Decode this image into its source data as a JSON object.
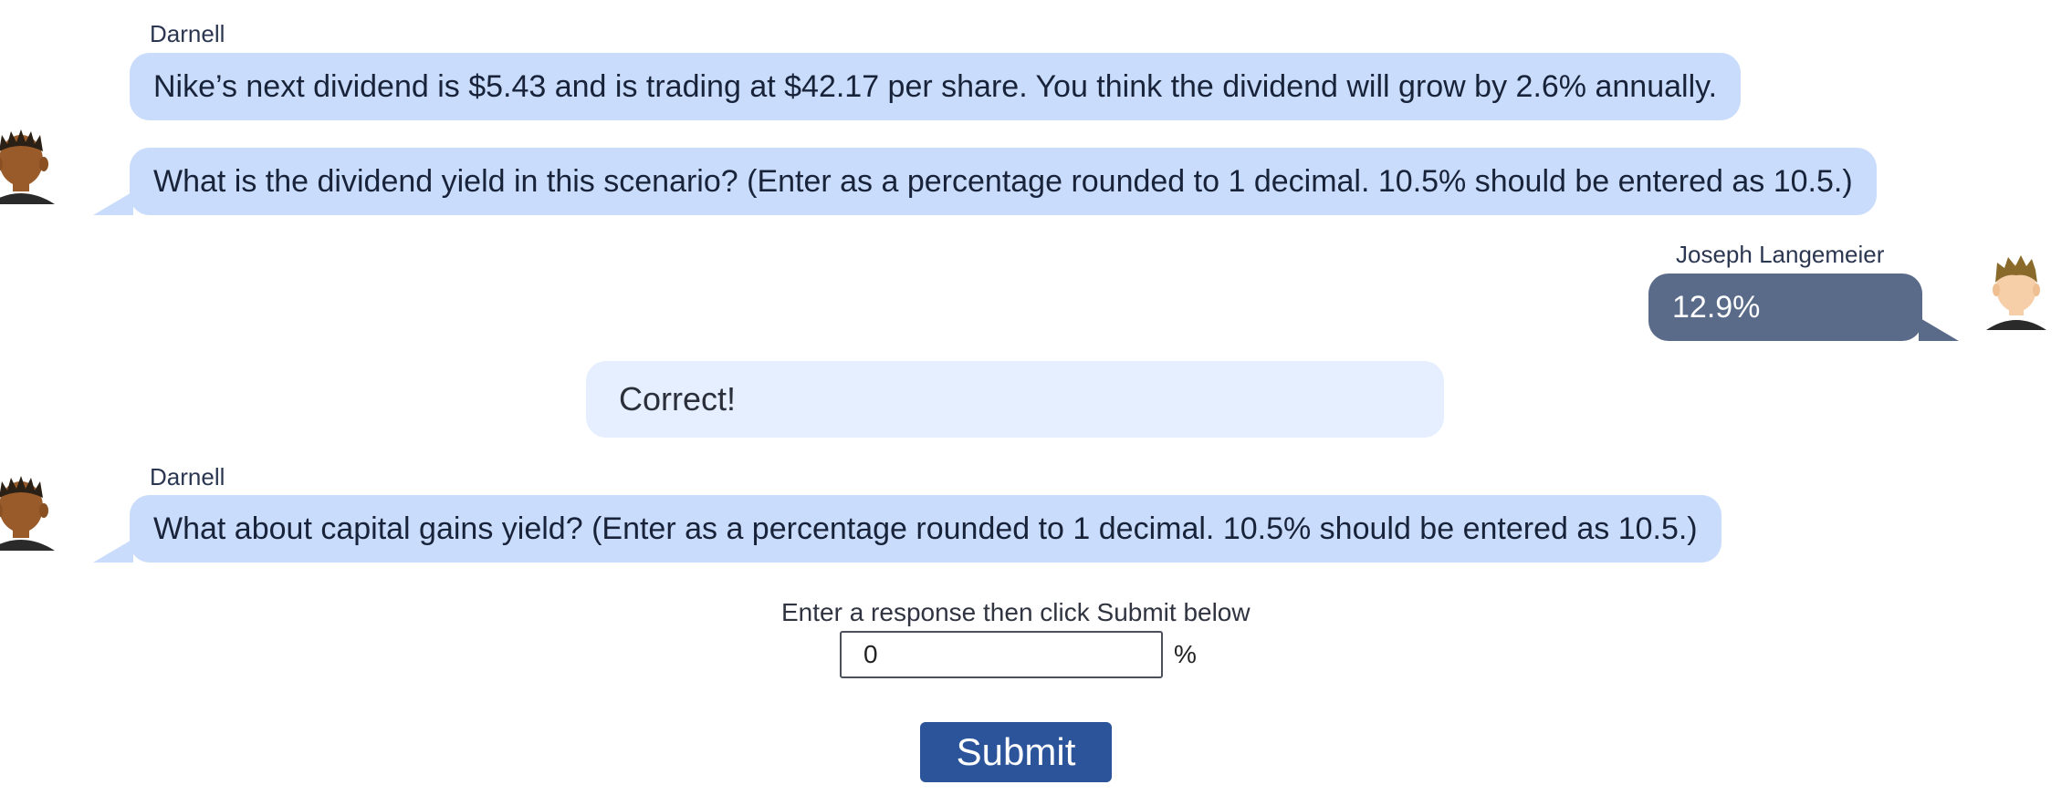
{
  "conversation": [
    {
      "sender": "Darnell",
      "messages": [
        "Nike’s next dividend is $5.43 and is trading at $42.17 per share. You think the dividend will grow by 2.6% annually.",
        "What is the dividend yield in this scenario? (Enter as a percentage rounded to 1 decimal. 10.5% should be entered as 10.5.)"
      ]
    },
    {
      "sender": "Joseph Langemeier",
      "messages": [
        "12.9%"
      ]
    },
    {
      "feedback": "Correct!"
    },
    {
      "sender": "Darnell",
      "messages": [
        "What about capital gains yield? (Enter as a percentage rounded to 1 decimal. 10.5% should be entered as 10.5.)"
      ]
    }
  ],
  "response_form": {
    "prompt": "Enter a response then click Submit below",
    "input_value": "0",
    "unit": "%",
    "submit_label": "Submit"
  },
  "avatars": {
    "bot_icon": "darnell-avatar-icon",
    "user_icon": "user-avatar-icon",
    "bot_skin": "#9a5b2a",
    "bot_hair": "#2a2016",
    "user_skin": "#f6cfa8",
    "user_hair": "#8a6a2a"
  },
  "colors": {
    "bot_bubble": "#c9dcfb",
    "user_bubble": "#5a6b8a",
    "feedback_bubble": "#e6efff",
    "submit_button": "#2c549b"
  }
}
